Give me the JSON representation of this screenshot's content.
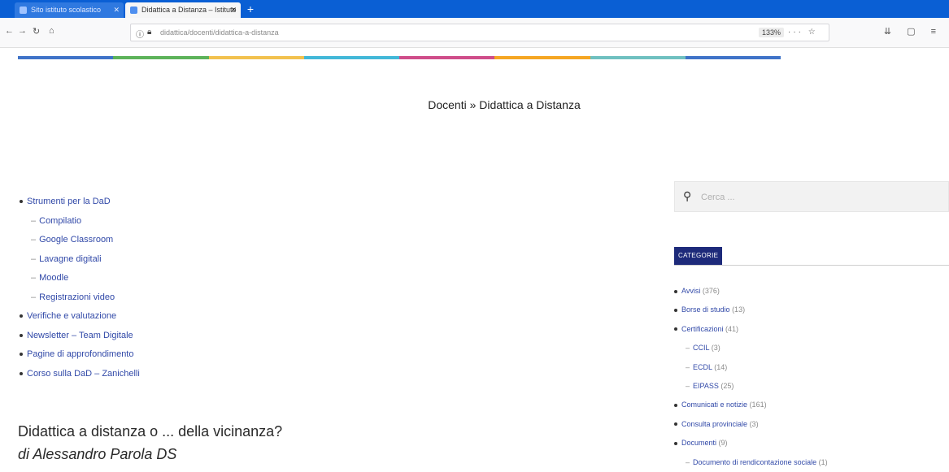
{
  "browser": {
    "tabs": [
      {
        "label": "Sito istituto scolastico",
        "active": false
      },
      {
        "label": "Didattica a Distanza – Istituto",
        "active": true
      }
    ],
    "url": "didattica/docenti/didattica-a-distanza",
    "zoom": "133%"
  },
  "colors": {
    "accent_dark": "#1d2a7a",
    "link": "#3149a8",
    "bar": [
      "#3f73c8",
      "#5db35a",
      "#f2c14e",
      "#42b8d8",
      "#cf4d8a",
      "#f5a623",
      "#6fc0c0",
      "#3f73c8"
    ]
  },
  "page": {
    "title": "Docenti » Didattica a Distanza"
  },
  "menu": [
    {
      "label": "Strumenti per la DaD",
      "sub": false
    },
    {
      "label": "Compilatio",
      "sub": true
    },
    {
      "label": "Google Classroom",
      "sub": true
    },
    {
      "label": "Lavagne digitali",
      "sub": true
    },
    {
      "label": "Moodle",
      "sub": true
    },
    {
      "label": "Registrazioni video",
      "sub": true
    },
    {
      "label": "Verifiche e valutazione",
      "sub": false
    },
    {
      "label": "Newsletter – Team Digitale",
      "sub": false
    },
    {
      "label": "Pagine di approfondimento",
      "sub": false
    },
    {
      "label": "Corso sulla DaD – Zanichelli",
      "sub": false
    }
  ],
  "post": {
    "title": "Didattica a distanza o ... della vicinanza?",
    "author": "di Alessandro Parola DS"
  },
  "sidebar": {
    "search_placeholder": "Cerca ...",
    "categories_label": "CATEGORIE",
    "categories": [
      {
        "label": "Avvisi",
        "count": "(376)",
        "sub": false
      },
      {
        "label": "Borse di studio",
        "count": "(13)",
        "sub": false
      },
      {
        "label": "Certificazioni",
        "count": "(41)",
        "sub": false
      },
      {
        "label": "CCIL",
        "count": "(3)",
        "sub": true
      },
      {
        "label": "ECDL",
        "count": "(14)",
        "sub": true
      },
      {
        "label": "EIPASS",
        "count": "(25)",
        "sub": true
      },
      {
        "label": "Comunicati e notizie",
        "count": "(161)",
        "sub": false
      },
      {
        "label": "Consulta provinciale",
        "count": "(3)",
        "sub": false
      },
      {
        "label": "Documenti",
        "count": "(9)",
        "sub": false
      },
      {
        "label": "Documento di rendicontazione sociale",
        "count": "(1)",
        "sub": true
      }
    ]
  }
}
